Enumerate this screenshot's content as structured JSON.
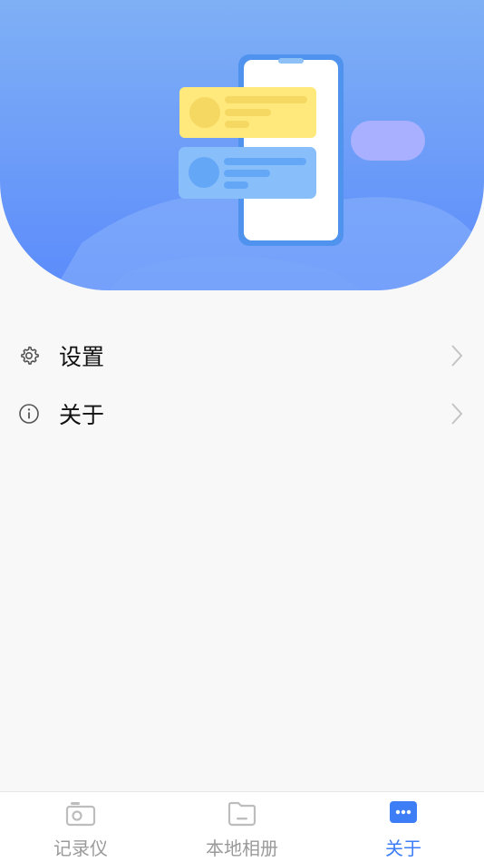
{
  "menu": {
    "items": [
      {
        "label": "设置",
        "icon": "gear-icon"
      },
      {
        "label": "关于",
        "icon": "info-icon"
      }
    ]
  },
  "tabbar": {
    "tabs": [
      {
        "label": "记录仪",
        "icon": "camera-icon",
        "active": false
      },
      {
        "label": "本地相册",
        "icon": "folder-icon",
        "active": false
      },
      {
        "label": "关于",
        "icon": "chat-bubble-icon",
        "active": true
      }
    ]
  },
  "colors": {
    "accent": "#3d7ef6",
    "inactive": "#9a9a9a",
    "hero_top": "#7fb0f5",
    "hero_bottom": "#5b8bfb"
  }
}
